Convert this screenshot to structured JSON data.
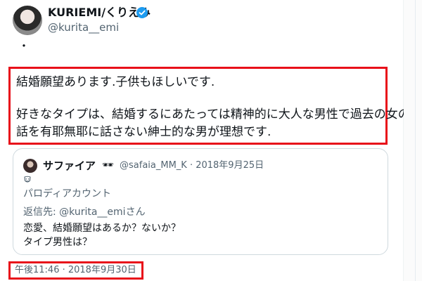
{
  "author": {
    "display_name": "KURIEMI/くりえみ",
    "handle": "@kurita__emi",
    "verified_icon": "verified-badge-icon"
  },
  "tweet": {
    "leading_char": "・",
    "line1": "結婚願望あります.子供もほしいです.",
    "line2": "好きなタイプは、結婚するにあたっては精神的に大人な男性で過去の女の",
    "line3": "話を有耶無耶に話さない紳士的な男が理想です."
  },
  "quoted": {
    "display_name": "サファイア",
    "glasses_emoji": "🕶",
    "meta": "@safaia_MM_K · 2018年9月25日",
    "parody_icon": "theater-mask-icon",
    "parody_label": "パロディアカウント",
    "reply_prefix": "返信先: ",
    "reply_handle": "@kurita__emiさん",
    "text_line1": "恋愛、結婚願望はあるか？ないか？",
    "text_line2": "タイプ男性は？"
  },
  "timestamp": "午後11:46 · 2018年9月30日",
  "colors": {
    "highlight_border": "#e8101a",
    "verified_blue": "#1d9bf0",
    "secondary_text": "#536471"
  }
}
